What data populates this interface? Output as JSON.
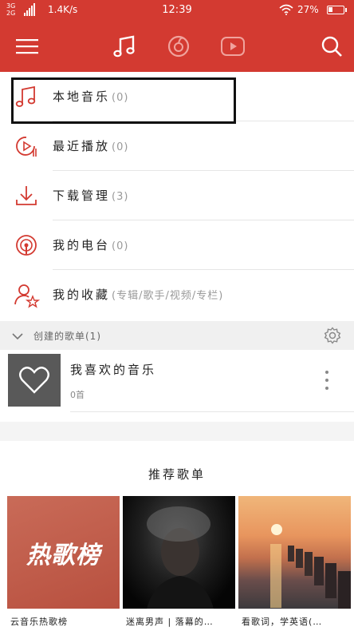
{
  "status_bar": {
    "network_top": "3G",
    "network_bottom": "2G",
    "speed": "1.4K/s",
    "time": "12:39",
    "battery_pct": "27%"
  },
  "top_bar": {
    "menu_icon": "hamburger-menu-icon",
    "tab_icons": [
      "music-note-icon",
      "netease-disc-icon",
      "video-play-icon"
    ],
    "search_icon": "search-icon",
    "accent_color": "#d33a31"
  },
  "menu": [
    {
      "label": "本地音乐",
      "count": "(0)",
      "icon": "music-note-icon"
    },
    {
      "label": "最近播放",
      "count": "(0)",
      "icon": "recent-play-icon"
    },
    {
      "label": "下载管理",
      "count": "(3)",
      "icon": "download-icon"
    },
    {
      "label": "我的电台",
      "count": "(0)",
      "icon": "radio-icon"
    },
    {
      "label": "我的收藏",
      "count": "(专辑/歌手/视频/专栏)",
      "icon": "favorite-user-star-icon"
    }
  ],
  "section": {
    "title": "创建的歌单(1)"
  },
  "playlist": {
    "name": "我喜欢的音乐",
    "sub": "0首"
  },
  "recommend": {
    "title": "推荐歌单",
    "cards": [
      {
        "caption": "云音乐热歌榜",
        "logo": "热歌榜"
      },
      {
        "caption": "迷离男声 | 落幕的…"
      },
      {
        "caption": "看歌词，学英语(…"
      }
    ]
  }
}
